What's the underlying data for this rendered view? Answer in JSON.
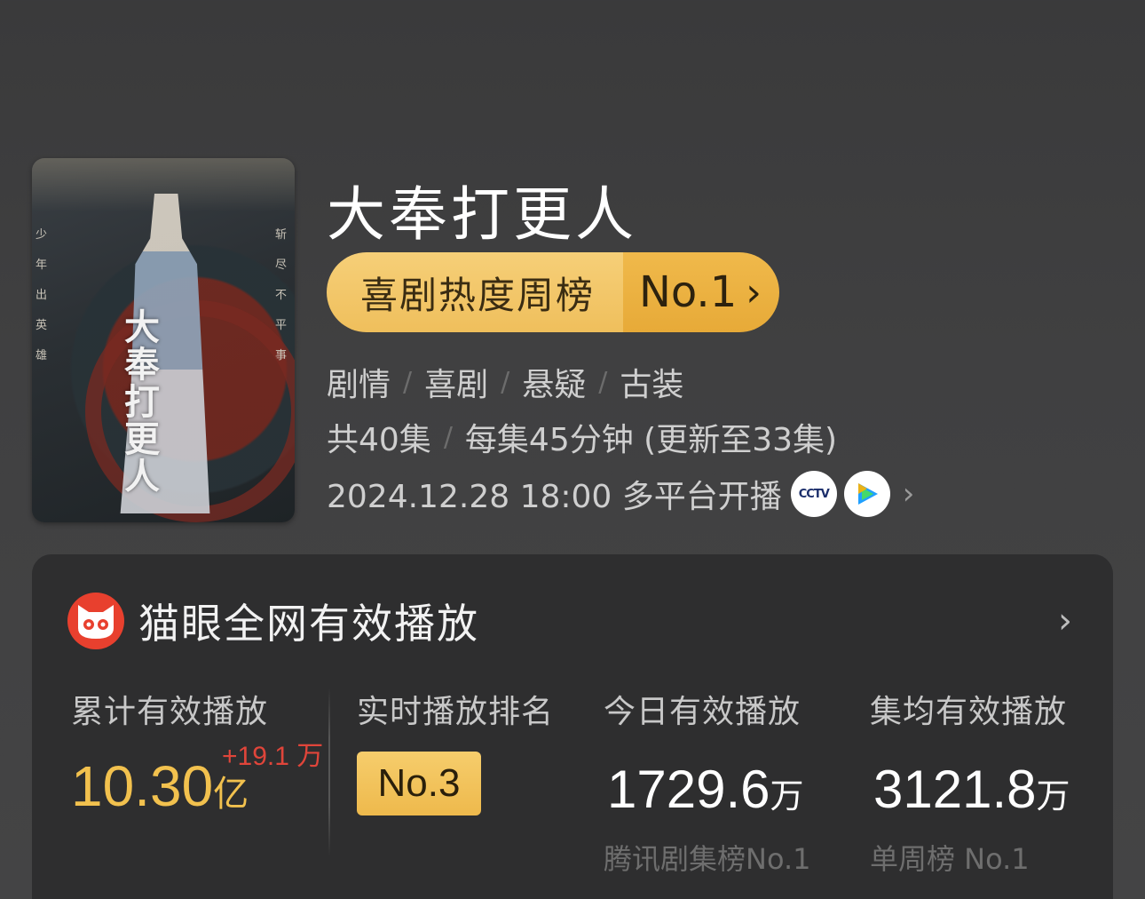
{
  "poster": {
    "calligraphy": [
      "大",
      "奉",
      "打",
      "更",
      "人"
    ],
    "side_left": "少年出英雄",
    "side_right": "斩尽不平事"
  },
  "show": {
    "title": "大奉打更人",
    "rank_label": "喜剧热度周榜",
    "rank_value": "No.1",
    "genres": [
      "剧情",
      "喜剧",
      "悬疑",
      "古装"
    ],
    "episodes_total": "共40集",
    "episode_length": "每集45分钟 (更新至33集)",
    "release": "2024.12.28 18:00 多平台开播",
    "platform_icons": [
      "cctv-icon",
      "tencent-video-icon"
    ]
  },
  "stats": {
    "title": "猫眼全网有效播放",
    "total": {
      "label": "累计有效播放",
      "value": "10.30",
      "unit": "亿",
      "delta": "+19.1 万"
    },
    "realtime_rank": {
      "label": "实时播放排名",
      "value": "No.3"
    },
    "today": {
      "label": "今日有效播放",
      "value": "1729.6",
      "unit": "万",
      "sub": "腾讯剧集榜No.1"
    },
    "average": {
      "label": "集均有效播放",
      "value": "3121.8",
      "unit": "万",
      "sub": "单周榜 No.1"
    }
  },
  "colors": {
    "accent_gold": "#f2c14e",
    "delta_red": "#e0453a",
    "maoyan_red": "#e8402e"
  }
}
